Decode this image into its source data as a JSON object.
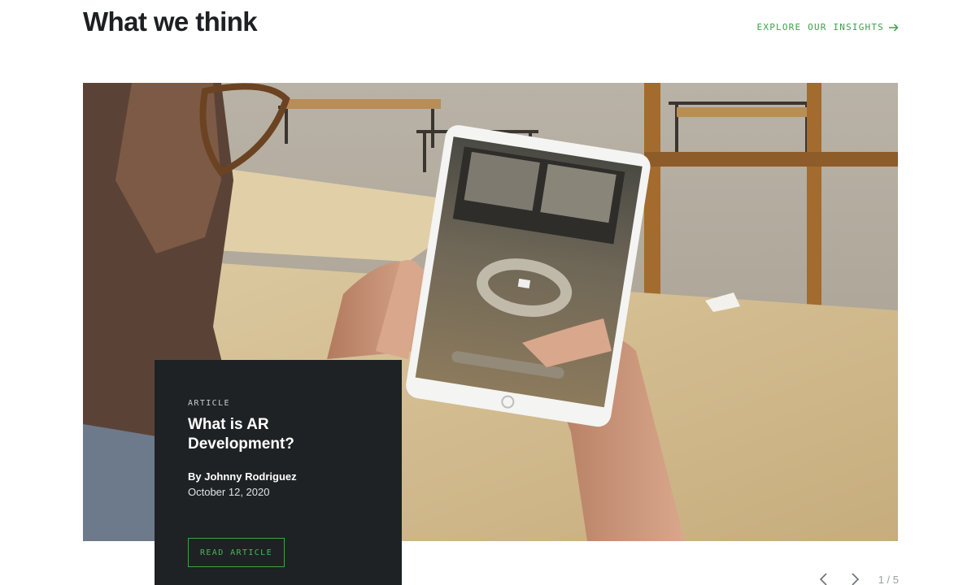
{
  "header": {
    "title": "What we think",
    "explore_label": "EXPLORE OUR INSIGHTS",
    "explore_icon": "arrow-right-icon"
  },
  "featured": {
    "image_alt": "Man holding a tablet showing an AR anchor on a table",
    "kicker": "ARTICLE",
    "title": "What is AR Development?",
    "author": "By Johnny Rodriguez",
    "date": "October 12, 2020",
    "cta_label": "READ ARTICLE"
  },
  "pager": {
    "prev_icon": "chevron-left-icon",
    "next_icon": "chevron-right-icon",
    "count": "1 / 5"
  },
  "colors": {
    "accent": "#3fa04a",
    "card_bg": "#1e2224",
    "title": "#1c2022"
  }
}
